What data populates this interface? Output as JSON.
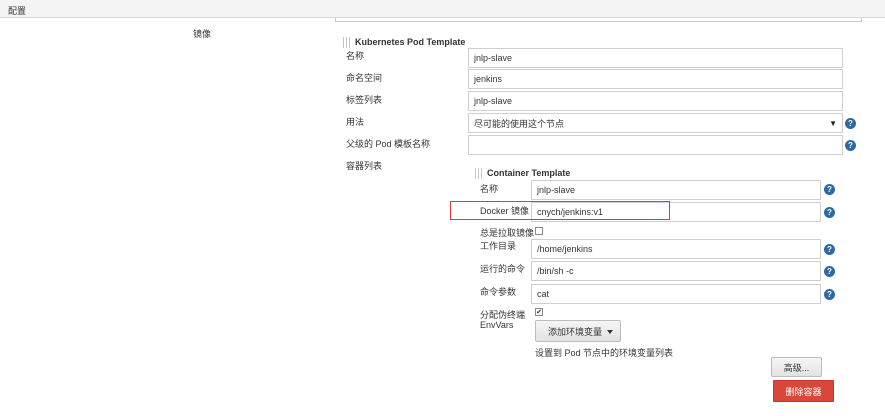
{
  "header": {
    "title": "配置"
  },
  "left": {
    "label": "镜像"
  },
  "pod_template": {
    "section_title": "Kubernetes Pod Template",
    "name_label": "名称",
    "name_value": "jnlp-slave",
    "namespace_label": "命名空间",
    "namespace_value": "jenkins",
    "labels_label": "标签列表",
    "labels_value": "jnlp-slave",
    "usage_label": "用法",
    "usage_value": "尽可能的使用这个节点",
    "parent_label": "父级的 Pod 模板名称",
    "parent_value": "",
    "containers_label": "容器列表"
  },
  "container": {
    "section_title": "Container Template",
    "name_label": "名称",
    "name_value": "jnlp-slave",
    "image_label": "Docker 镜像",
    "image_value": "cnych/jenkins:v1",
    "always_pull_label": "总是拉取镜像",
    "always_pull_checked": "",
    "workdir_label": "工作目录",
    "workdir_value": "/home/jenkins",
    "command_label": "运行的命令",
    "command_value": "/bin/sh -c",
    "args_label": "命令参数",
    "args_value": "cat",
    "tty_label": "分配伪终端",
    "tty_checked": "✔",
    "envvars_label": "EnvVars",
    "add_env_button": "添加环境变量",
    "env_help_text": "设置到 Pod 节点中的环境变量列表"
  },
  "buttons": {
    "advanced": "高级...",
    "delete_container": "删除容器"
  },
  "help_icon_glyph": "?",
  "select_arrow_glyph": "▼",
  "colors": {
    "help_icon": "#2d6aa3",
    "highlight_box": "#e53935",
    "delete_button": "#d9473b"
  }
}
